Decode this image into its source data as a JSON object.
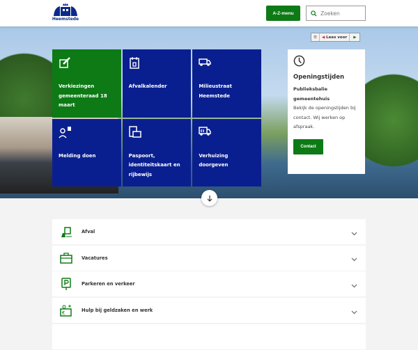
{
  "header": {
    "logo_text": "Heemstede",
    "az_menu": "A-Z-menu",
    "search_placeholder": "Zoeken"
  },
  "readspeaker": {
    "label": "Lees voor"
  },
  "tiles": [
    {
      "label": "Verkiezingen gemeenteraad 18 maart",
      "icon": "ballot-icon"
    },
    {
      "label": "Afvalkalender",
      "icon": "calendar-icon"
    },
    {
      "label": "Milieustraat Heemstede",
      "icon": "truck-icon"
    },
    {
      "label": "Melding doen",
      "icon": "person-alert-icon"
    },
    {
      "label": "Paspoort, identiteitskaart en rijbewijs",
      "icon": "id-card-icon"
    },
    {
      "label": "Verhuizing doorgeven",
      "icon": "moving-truck-icon"
    }
  ],
  "opening": {
    "title": "Openingstijden",
    "subtitle": "Publieksbalie gemeentehuis",
    "text": "Bekijk de openingstijden bij contact. Wij werken op afspraak.",
    "button": "Contact"
  },
  "accordion": [
    {
      "label": "Afval"
    },
    {
      "label": "Vacatures"
    },
    {
      "label": "Parkeren en verkeer"
    },
    {
      "label": "Hulp bij geldzaken en werk"
    }
  ],
  "colors": {
    "green": "#0d7a16",
    "blue": "#0a1f8f"
  }
}
